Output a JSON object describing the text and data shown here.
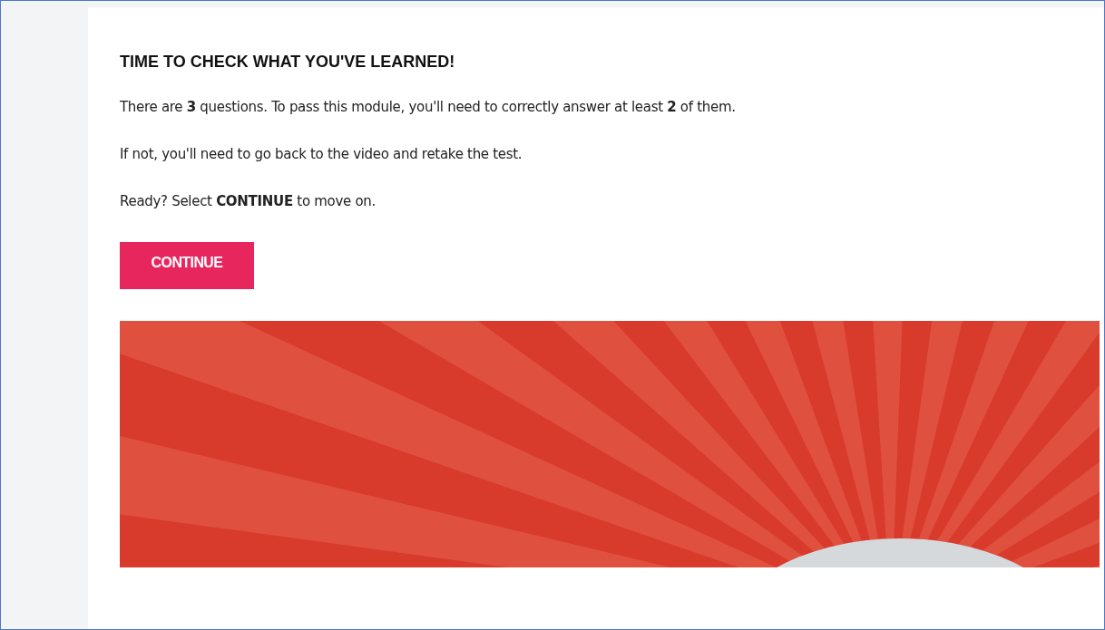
{
  "heading": "TIME TO CHECK WHAT YOU'VE LEARNED!",
  "paragraphs": [
    "There are **3** questions. To pass this module, you'll need to correctly answer at least **2** of them.",
    "If not, you'll need to go back to the video and retake the test.",
    "Ready? Select **CONTINUE** to move on."
  ],
  "button": "CONTINUE"
}
